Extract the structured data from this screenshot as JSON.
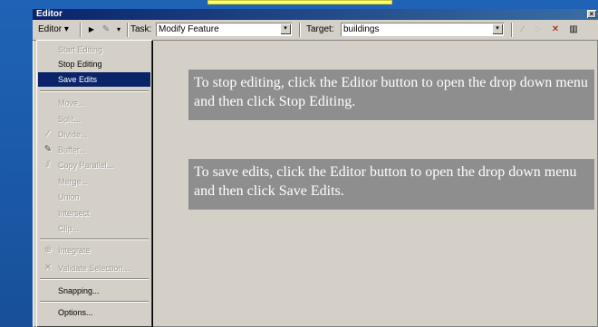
{
  "window": {
    "title": "Editor",
    "close_glyph": "×"
  },
  "toolbar": {
    "editor_label": "Editor",
    "editor_dropdown_glyph": "▾",
    "sketch_glyph": "▶",
    "pencil_glyph": "✎",
    "pencil_dropdown_glyph": "▾",
    "task_label": "Task:",
    "task_value": "Modify Feature",
    "target_label": "Target:",
    "target_value": "buildings",
    "combo_arrow_glyph": "▾",
    "icons": [
      "sketch-tool-icon",
      "pencil-icon",
      "edit-vertices-icon",
      "rotate-icon",
      "delete-icon",
      "attributes-icon"
    ]
  },
  "menu": {
    "items": [
      {
        "label": "Start Editing",
        "state": "disabled"
      },
      {
        "label": "Stop Editing",
        "state": "enabled"
      },
      {
        "label": "Save Edits",
        "state": "selected"
      },
      {
        "label": "Move...",
        "state": "disabled"
      },
      {
        "label": "Split...",
        "state": "disabled"
      },
      {
        "label": "Divide...",
        "state": "disabled"
      },
      {
        "label": "Buffer...",
        "state": "disabled"
      },
      {
        "label": "Copy Parallel...",
        "state": "disabled"
      },
      {
        "label": "Merge...",
        "state": "disabled"
      },
      {
        "label": "Union",
        "state": "disabled"
      },
      {
        "label": "Intersect",
        "state": "disabled"
      },
      {
        "label": "Clip...",
        "state": "disabled"
      },
      {
        "label": "Integrate",
        "state": "disabled"
      },
      {
        "label": "Validate Selection...",
        "state": "disabled"
      },
      {
        "label": "Snapping...",
        "state": "enabled"
      },
      {
        "label": "Options...",
        "state": "enabled"
      }
    ]
  },
  "callouts": {
    "stop": "To stop editing, click the Editor button to open the drop down menu and then click Stop Editing.",
    "save": "To save edits, click the Editor button to open the drop down menu and then click Save Edits."
  },
  "colors": {
    "background": "#1f63b6",
    "highlight": "#ffff66",
    "window_face": "#d4d0c8",
    "selection": "#0a246a",
    "callout_bg": "#8e8e8e"
  }
}
